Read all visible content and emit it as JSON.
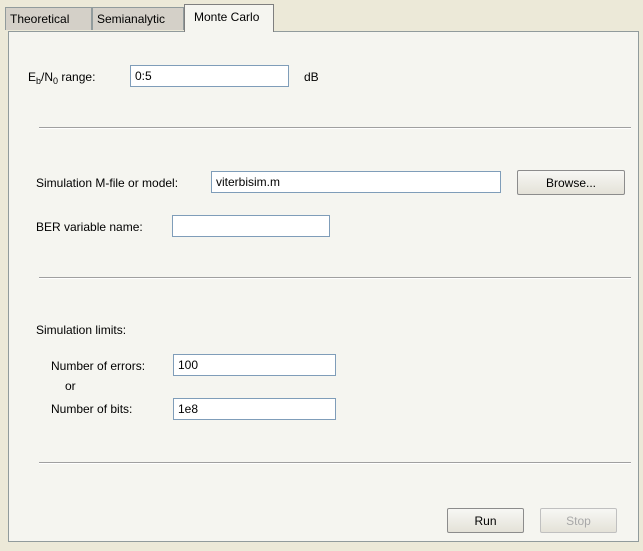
{
  "tabs": [
    "Theoretical",
    "Semianalytic",
    "Monte Carlo"
  ],
  "ebn0": {
    "label_e": "E",
    "label_b": "b",
    "label_slash": "/N",
    "label_0": "0",
    "label_rest": " range:",
    "value": "0:5",
    "unit": "dB"
  },
  "simulation": {
    "model_label": "Simulation M-file or model:",
    "model_value": "viterbisim.m",
    "browse_label": "Browse...",
    "ber_label": "BER variable name:",
    "ber_value": ""
  },
  "limits": {
    "title": "Simulation limits:",
    "errors_label": "Number of errors:",
    "errors_value": "100",
    "or_label": "or",
    "bits_label": "Number of bits:",
    "bits_value": "1e8"
  },
  "actions": {
    "run_label": "Run",
    "stop_label": "Stop"
  }
}
